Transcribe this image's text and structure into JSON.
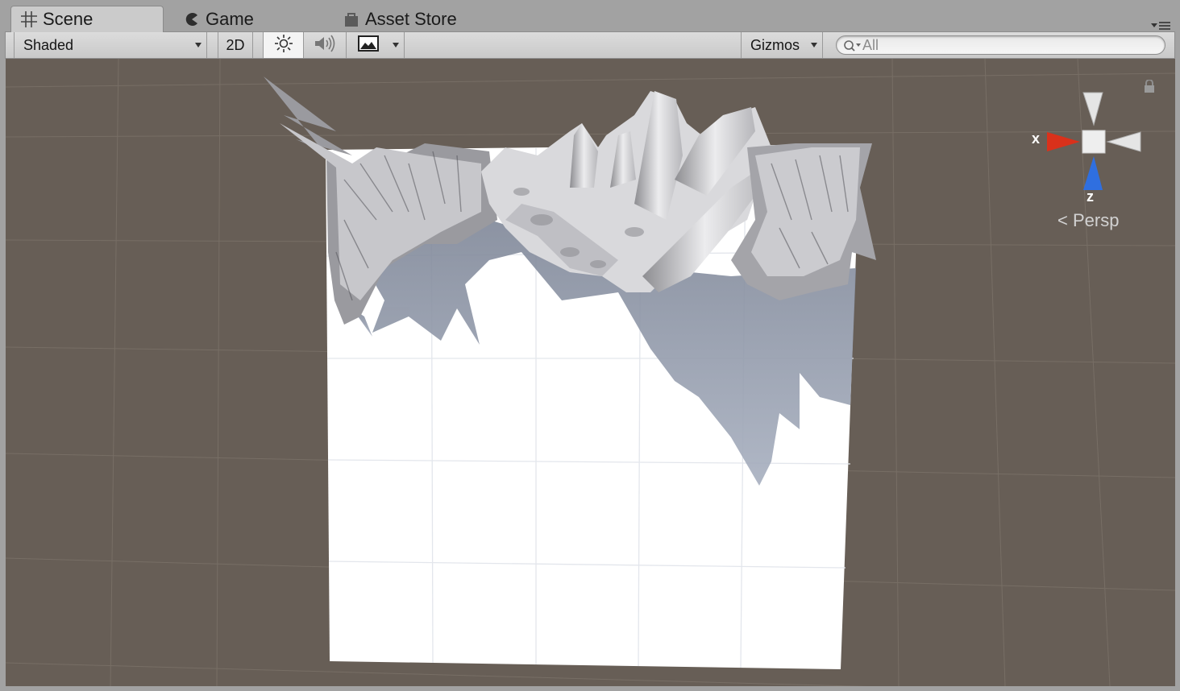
{
  "tabs": [
    {
      "label": "Scene",
      "icon": "grid-icon",
      "active": true
    },
    {
      "label": "Game",
      "icon": "pacman-icon",
      "active": false
    },
    {
      "label": "Asset Store",
      "icon": "store-bag-icon",
      "active": false
    }
  ],
  "toolbar": {
    "draw_mode": "Shaded",
    "mode_2d": "2D",
    "lighting_icon": "sun-icon",
    "audio_icon": "speaker-icon",
    "effects_icon": "image-icon",
    "gizmos": "Gizmos",
    "search_placeholder": "All"
  },
  "viewport": {
    "background": "#675e56",
    "axis_x": "x",
    "axis_z": "z",
    "projection": "Persp"
  }
}
